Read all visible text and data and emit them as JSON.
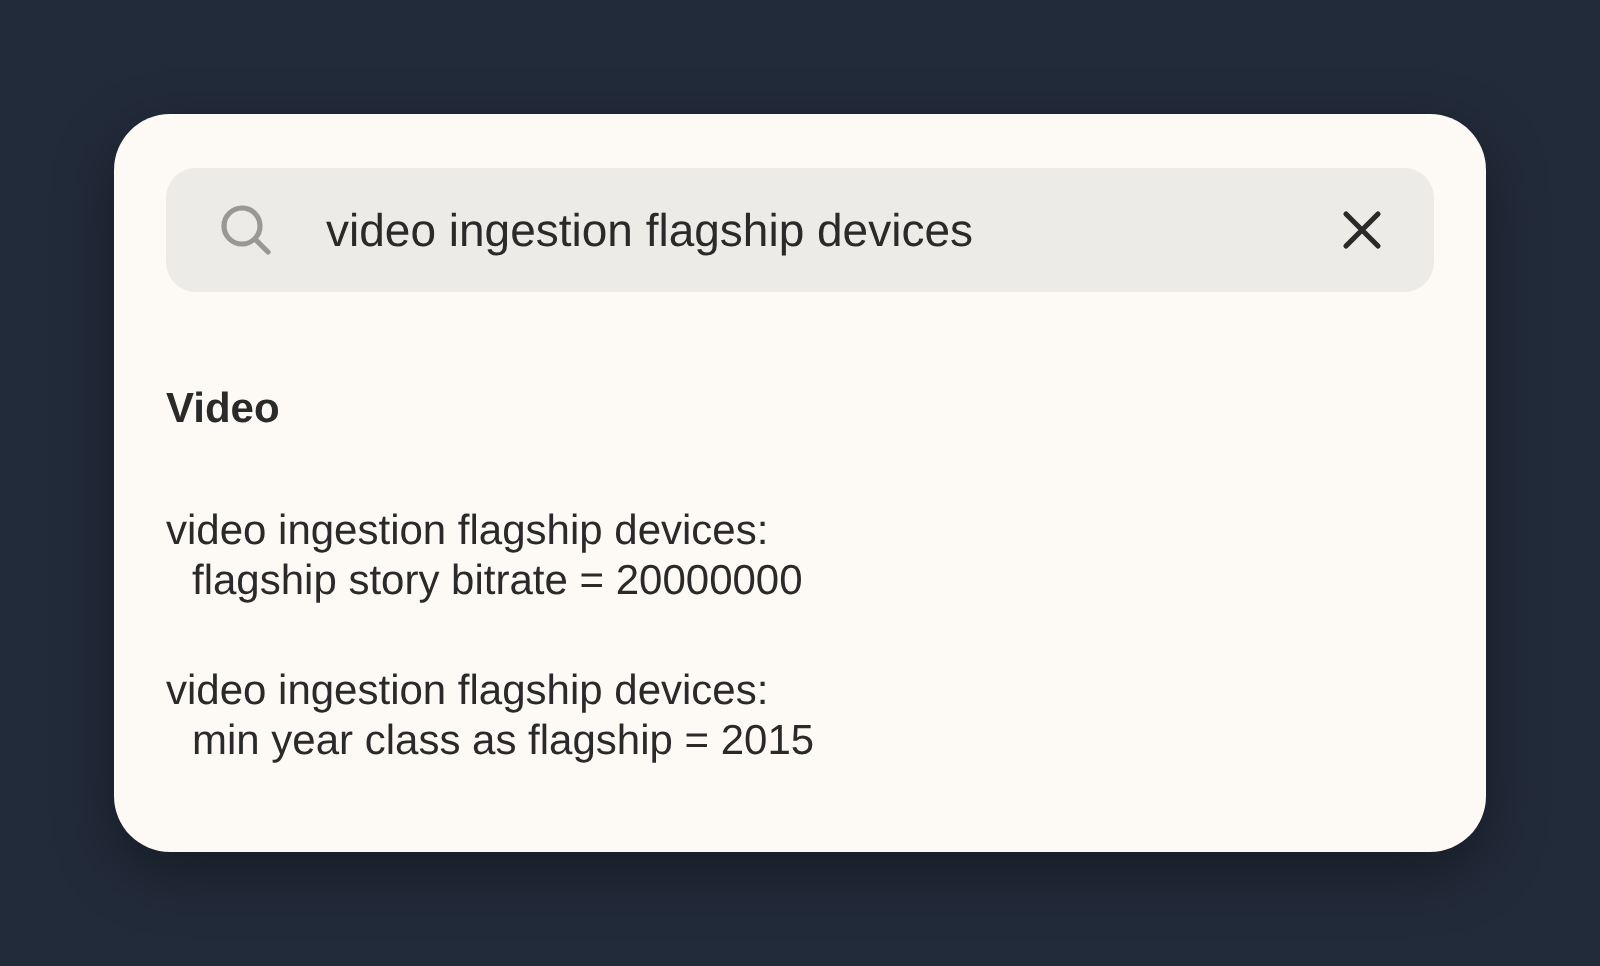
{
  "search": {
    "value": "video ingestion flagship devices"
  },
  "section": {
    "title": "Video"
  },
  "results": [
    {
      "title": "video ingestion flagship devices:",
      "setting": "flagship story bitrate = 20000000"
    },
    {
      "title": "video ingestion flagship devices:",
      "setting": "min year class as flagship = 2015"
    }
  ]
}
